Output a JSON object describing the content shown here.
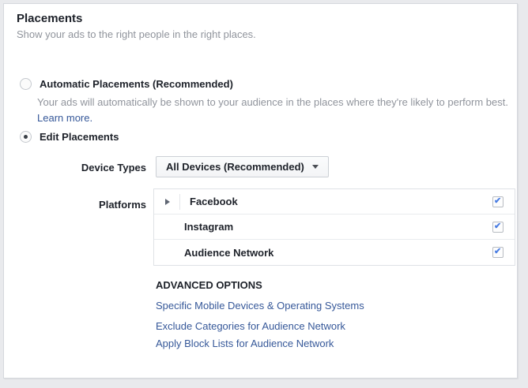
{
  "colors": {
    "page_background": "#e9eaed",
    "card_background": "#ffffff",
    "primary_text": "#1d2129",
    "secondary_text": "#90949c",
    "link_blue": "#365899",
    "checkmark_blue": "#4a7de2"
  },
  "header": {
    "title": "Placements",
    "subtitle": "Show your ads to the right people in the right places."
  },
  "options": {
    "automatic": {
      "label": "Automatic Placements (Recommended)",
      "selected": false,
      "description": "Your ads will automatically be shown to your audience in the places where they're likely to perform best.",
      "learn_more_label": "Learn more."
    },
    "edit": {
      "label": "Edit Placements",
      "selected": true
    }
  },
  "device_types": {
    "label": "Device Types",
    "selected_value": "All Devices (Recommended)"
  },
  "platforms": {
    "label": "Platforms",
    "rows": [
      {
        "label": "Facebook",
        "expandable": true,
        "checked": true
      },
      {
        "label": "Instagram",
        "expandable": false,
        "checked": true
      },
      {
        "label": "Audience Network",
        "expandable": false,
        "checked": true
      }
    ]
  },
  "advanced_options": {
    "heading": "ADVANCED OPTIONS",
    "links": [
      "Specific Mobile Devices & Operating Systems",
      "Exclude Categories for Audience Network",
      "Apply Block Lists for Audience Network"
    ]
  }
}
